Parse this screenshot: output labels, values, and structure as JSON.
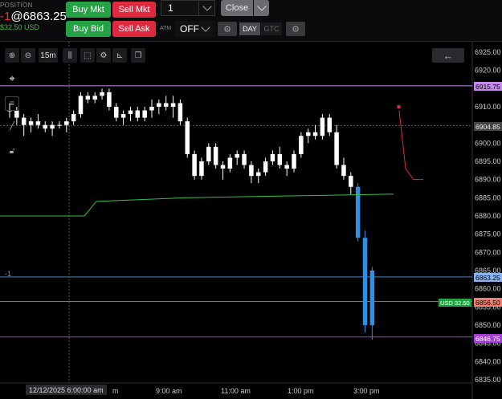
{
  "position": {
    "label": "POSITION",
    "qty": "-1",
    "value": "@6863.25",
    "pnl": "$32.50 USD"
  },
  "buttons": {
    "buy_mkt": "Buy Mkt",
    "sell_mkt": "Sell Mkt",
    "buy_bid": "Buy Bid",
    "sell_ask": "Sell Ask",
    "close": "Close"
  },
  "quantity": {
    "value": "1"
  },
  "atm": {
    "label": "ATM",
    "value": "OFF"
  },
  "tif": {
    "day": "DAY",
    "gtc": "GTC"
  },
  "chart_toolbar": {
    "interval": "15m"
  },
  "colors": {
    "up": "#ffffff",
    "down": "#ffffff",
    "live": "#2f8fe0",
    "ema_green": "#35c04a",
    "ema_red": "#e0283e",
    "upper_line": "#c48be8",
    "lower_line": "#a040d0",
    "entry_line": "#5a8fd8",
    "current_line": "#f08070"
  },
  "price_axis": {
    "ticks": [
      "6925.00",
      "6920.00",
      "6910.00",
      "6905.00",
      "6900.00",
      "6895.00",
      "6890.00",
      "6885.00",
      "6880.00",
      "6875.00",
      "6870.00",
      "6865.00",
      "6860.00",
      "6855.00",
      "6850.00",
      "6845.00",
      "6840.00",
      "6835.00"
    ],
    "tags": {
      "upper": "6915.75",
      "crosshair": "6904.85",
      "entry": "6863.25",
      "current": "6856.50",
      "lower": "6846.75"
    }
  },
  "time_axis": {
    "labels": [
      "m",
      "9:00 am",
      "11:00 am",
      "1:00 pm",
      "3:00 pm"
    ],
    "crosshair": "12/12/2025 6:00:00 am"
  },
  "position_line_label": "-1",
  "pnl_tag": "USD 32.50",
  "chart_data": {
    "type": "candlestick",
    "ylim": [
      6832,
      6928
    ],
    "candles": [
      [
        6909,
        6911,
        6907,
        6909
      ],
      [
        6909,
        6910,
        6905,
        6907
      ],
      [
        6907,
        6908,
        6902,
        6905
      ],
      [
        6905,
        6907,
        6903,
        6906
      ],
      [
        6906,
        6908,
        6904,
        6905
      ],
      [
        6905,
        6906,
        6903,
        6904
      ],
      [
        6904,
        6906,
        6902,
        6905
      ],
      [
        6905,
        6906,
        6904,
        6905
      ],
      [
        6905,
        6907,
        6903,
        6906
      ],
      [
        6906,
        6909,
        6905,
        6908
      ],
      [
        6908,
        6914,
        6907,
        6913
      ],
      [
        6913,
        6914,
        6911,
        6912
      ],
      [
        6912,
        6914,
        6911,
        6913
      ],
      [
        6913,
        6915,
        6912,
        6914
      ],
      [
        6914,
        6915,
        6909,
        6910
      ],
      [
        6910,
        6911,
        6906,
        6907
      ],
      [
        6907,
        6909,
        6905,
        6908
      ],
      [
        6908,
        6910,
        6906,
        6909
      ],
      [
        6909,
        6910,
        6906,
        6907
      ],
      [
        6907,
        6910,
        6906,
        6909
      ],
      [
        6909,
        6912,
        6907,
        6910
      ],
      [
        6910,
        6912,
        6908,
        6911
      ],
      [
        6911,
        6913,
        6909,
        6910
      ],
      [
        6910,
        6913,
        6907,
        6911
      ],
      [
        6911,
        6912,
        6905,
        6906
      ],
      [
        6906,
        6907,
        6896,
        6897
      ],
      [
        6897,
        6898,
        6890,
        6891
      ],
      [
        6891,
        6896,
        6890,
        6895
      ],
      [
        6895,
        6900,
        6894,
        6899
      ],
      [
        6899,
        6900,
        6893,
        6894
      ],
      [
        6894,
        6895,
        6890,
        6893
      ],
      [
        6893,
        6897,
        6892,
        6896
      ],
      [
        6896,
        6898,
        6894,
        6897
      ],
      [
        6897,
        6898,
        6893,
        6894
      ],
      [
        6894,
        6895,
        6889,
        6891
      ],
      [
        6891,
        6893,
        6889,
        6892
      ],
      [
        6892,
        6896,
        6891,
        6895
      ],
      [
        6895,
        6898,
        6894,
        6897
      ],
      [
        6897,
        6899,
        6893,
        6894
      ],
      [
        6894,
        6895,
        6891,
        6893
      ],
      [
        6893,
        6898,
        6892,
        6897
      ],
      [
        6897,
        6903,
        6896,
        6902
      ],
      [
        6902,
        6904,
        6900,
        6903
      ],
      [
        6903,
        6905,
        6901,
        6902
      ],
      [
        6902,
        6908,
        6901,
        6907
      ],
      [
        6907,
        6908,
        6902,
        6903
      ],
      [
        6903,
        6905,
        6893,
        6894
      ],
      [
        6894,
        6896,
        6890,
        6891
      ],
      [
        6891,
        6892,
        6886,
        6888
      ],
      [
        6888,
        6889,
        6873,
        6874
      ],
      [
        6874,
        6876,
        6848,
        6850
      ],
      [
        6850,
        6866,
        6846,
        6865
      ]
    ],
    "ema_green": [
      [
        0,
        6880
      ],
      [
        21,
        6880
      ],
      [
        25,
        6884
      ],
      [
        38,
        6885
      ],
      [
        49,
        6886
      ],
      [
        82,
        6886
      ],
      [
        80,
        6887.5
      ],
      [
        96,
        6887.5
      ]
    ],
    "ema_red": [
      [
        97,
        6909
      ],
      [
        99,
        6893
      ],
      [
        103,
        6890
      ],
      [
        105,
        6890
      ]
    ]
  }
}
